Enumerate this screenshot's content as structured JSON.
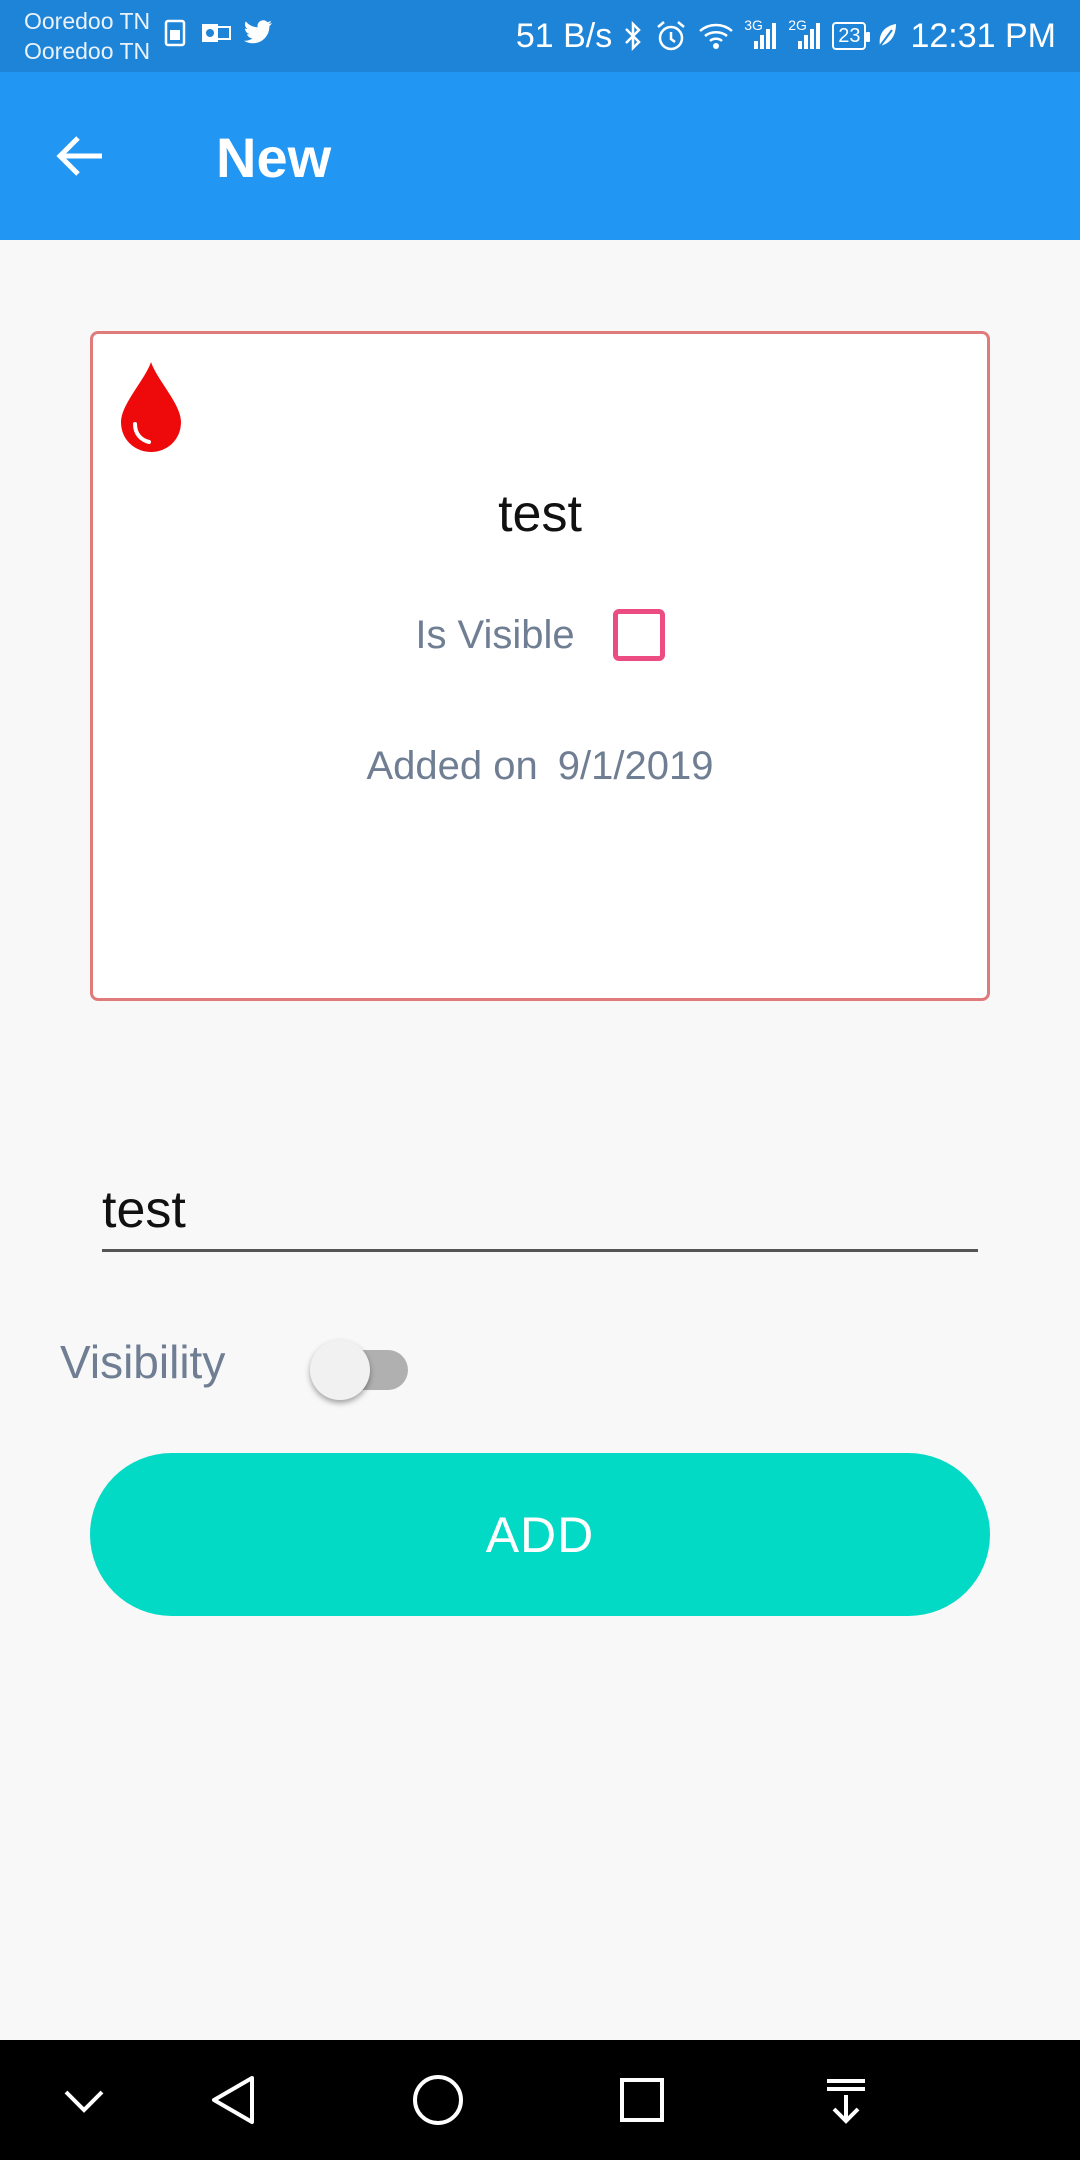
{
  "status_bar": {
    "carrier_1": "Ooredoo TN",
    "carrier_2": "Ooredoo TN",
    "data_speed": "51 B/s",
    "network_1": "3G",
    "network_2": "2G",
    "battery": "23",
    "time": "12:31 PM",
    "left_icons": [
      "sim-card-icon",
      "outlook-icon",
      "twitter-icon"
    ],
    "right_icons": [
      "bluetooth-icon",
      "alarm-icon",
      "wifi-icon",
      "signal-3g-icon",
      "signal-2g-icon",
      "battery-icon",
      "leaf-icon"
    ]
  },
  "app_bar": {
    "title": "New",
    "back_icon": "arrow-back-icon",
    "color": "#2196f3"
  },
  "card": {
    "icon": "blood-drop-icon",
    "title": "test",
    "visible_label": "Is Visible",
    "visible_checked": false,
    "added_label": "Added on",
    "added_date": "9/1/2019",
    "border_color": "#e07b7b"
  },
  "form": {
    "name_value": "test",
    "visibility_label": "Visibility",
    "visibility_on": false,
    "add_button": "ADD",
    "accent_color": "#03dac5"
  },
  "nav_bar": {
    "icons": [
      "chevron-down-icon",
      "back-triangle-icon",
      "home-circle-icon",
      "recents-square-icon",
      "notification-pull-icon"
    ]
  }
}
